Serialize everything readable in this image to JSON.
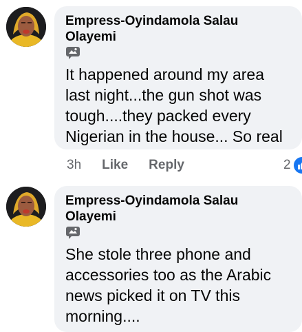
{
  "comments": [
    {
      "author": "Empress-Oyindamola Salau Olayemi",
      "badge_icon": "fan-badge-icon",
      "text": "It happened around my area last night...the gun shot was tough....they packed every Nigerian in the house... So real",
      "time": "3h",
      "like_label": "Like",
      "reply_label": "Reply",
      "reaction_count": "2",
      "reaction_icon": "like-icon",
      "reaction_color": "#1877f2"
    },
    {
      "author": "Empress-Oyindamola Salau Olayemi",
      "badge_icon": "fan-badge-icon",
      "text": "She stole three phone and accessories too as the Arabic news picked it on TV this morning...."
    }
  ]
}
